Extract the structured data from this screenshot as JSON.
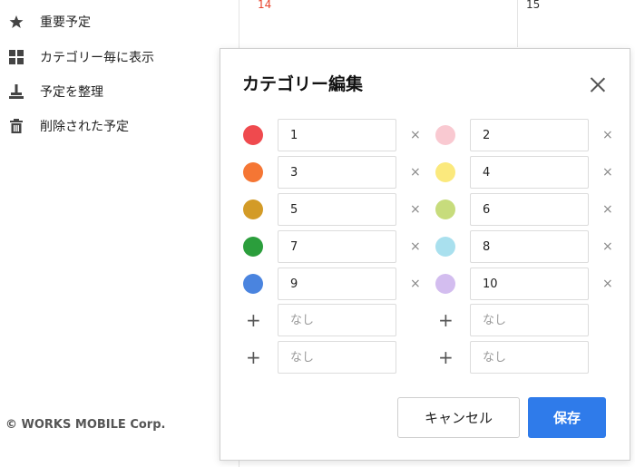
{
  "sidebar": {
    "items": [
      {
        "label": "重要予定",
        "icon": "star-icon"
      },
      {
        "label": "カテゴリー毎に表示",
        "icon": "grid-icon"
      },
      {
        "label": "予定を整理",
        "icon": "broom-icon"
      },
      {
        "label": "削除された予定",
        "icon": "trash-icon"
      }
    ],
    "footer": "© WORKS MOBILE Corp."
  },
  "calendar": {
    "day_14": "14",
    "day_15": "15",
    "colors": {
      "sunday": "#e8452e"
    }
  },
  "dialog": {
    "title": "カテゴリー編集",
    "close_icon": "close-icon",
    "placeholder": "なし",
    "categories": [
      {
        "value": "1",
        "color": "#ef4a4e"
      },
      {
        "value": "2",
        "color": "#f9c9d1"
      },
      {
        "value": "3",
        "color": "#f57634"
      },
      {
        "value": "4",
        "color": "#fbe97d"
      },
      {
        "value": "5",
        "color": "#d39b27"
      },
      {
        "value": "6",
        "color": "#c7dc7c"
      },
      {
        "value": "7",
        "color": "#2b9e3c"
      },
      {
        "value": "8",
        "color": "#a9e0ee"
      },
      {
        "value": "9",
        "color": "#4a84df"
      },
      {
        "value": "10",
        "color": "#d3bdef"
      }
    ],
    "empty_rows": [
      {
        "value": "",
        "icon": "plus-icon"
      },
      {
        "value": "",
        "icon": "plus-icon"
      },
      {
        "value": "",
        "icon": "plus-icon"
      },
      {
        "value": "",
        "icon": "plus-icon"
      }
    ],
    "delete_symbol": "×",
    "add_symbol": "+",
    "cancel_label": "キャンセル",
    "save_label": "保存",
    "accent_color": "#2f7bea"
  }
}
